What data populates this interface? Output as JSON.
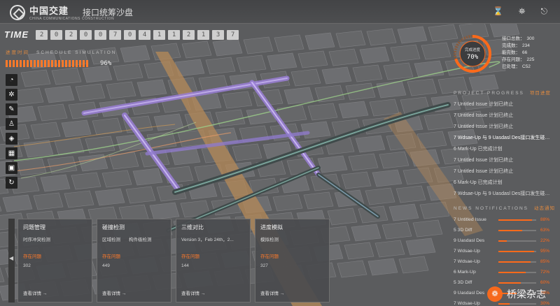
{
  "header": {
    "logo_text": "中国交建",
    "logo_sub": "CHINA COMMUNICATIONS CONSTRUCTION",
    "app_title": "接口统筹沙盘",
    "icons": [
      "hourglass-icon",
      "users-icon",
      "exit-icon"
    ]
  },
  "time": {
    "label": "TIME",
    "digits": [
      "2020",
      "07",
      "04",
      "11",
      "21",
      "37"
    ]
  },
  "schedule": {
    "label": "进度时间",
    "title": "SCHEDULE  SIMULATION"
  },
  "progress": {
    "percent_text": "96%",
    "value": 0.96
  },
  "sidebar_icons": [
    "pie-chart-icon",
    "gear-icon",
    "ruler-icon",
    "user-icon",
    "layers-icon",
    "map-icon",
    "grid-icon",
    "rotate-icon"
  ],
  "gauge": {
    "label": "完成进度",
    "value_text": "70%",
    "value": 0.7
  },
  "stats": [
    {
      "label": "接口总数：",
      "value": "300"
    },
    {
      "label": "完成数：",
      "value": "234"
    },
    {
      "label": "能完数：",
      "value": "66"
    },
    {
      "label": "存在问题：",
      "value": "225"
    },
    {
      "label": "已处理：",
      "value": "C52"
    }
  ],
  "project_progress": {
    "title": "PROJECT  PROGRESS",
    "tag": "项目进度",
    "items": [
      "7 Untitled Issue 计划已终止",
      "7 Untitled Issue 计划已终止",
      "7 Untitled Issue 计划已终止",
      "7 Wdsae-Up 与 9 Uasdasl Des接口发生碰…",
      "6 Mark-Up 已完成计划",
      "7 Untitled Issue 计划已终止",
      "7 Untitled Issue 计划已终止",
      "6 Mark-Up 已完成计划",
      "7 Wdsae-Up 与 9 Uasdasl Des接口发生碰…"
    ]
  },
  "notifications": {
    "title": "NEWS  NOTIFICATIONS",
    "tag": "动态通知",
    "items": [
      {
        "label": "7 Untitled Issue",
        "pct": "88%",
        "value": 0.88
      },
      {
        "label": "5 3D Diff",
        "pct": "63%",
        "value": 0.63
      },
      {
        "label": "9 Uasdasl Des",
        "pct": "22%",
        "value": 0.22
      },
      {
        "label": "7 Wdsae-Up",
        "pct": "95%",
        "value": 0.95
      },
      {
        "label": "7 Wdsae-Up",
        "pct": "85%",
        "value": 0.85
      },
      {
        "label": "6 Mark-Up",
        "pct": "72%",
        "value": 0.72
      },
      {
        "label": "5 3D Diff",
        "pct": "60%",
        "value": 0.6
      },
      {
        "label": "9 Uasdasl Des",
        "pct": "48%",
        "value": 0.48
      },
      {
        "label": "7 Wdsae-Up",
        "pct": "30%",
        "value": 0.3
      }
    ]
  },
  "cards": [
    {
      "title": "问题管理",
      "subs": [
        "时序冲突检测"
      ],
      "warn": "存在问题",
      "num": "302",
      "link": "查看详情"
    },
    {
      "title": "碰撞检测",
      "subs": [
        "区域检测",
        "构件级检测"
      ],
      "warn": "存在问题",
      "num": "449",
      "link": "查看详情"
    },
    {
      "title": "三维对比",
      "subs": [
        "Version 3，Feb 24th，2..."
      ],
      "warn": "存在问题",
      "num": "144",
      "link": "查看详情"
    },
    {
      "title": "进度模拟",
      "subs": [
        "模拟检测"
      ],
      "warn": "存在问题",
      "num": "327",
      "link": "查看详情"
    }
  ],
  "cards_toggle": "◀",
  "watermark": "桥梁杂志",
  "colors": {
    "accent": "#ff6a1a",
    "tunnel": "#9a7fd6",
    "road": "#c89a5a",
    "route_green": "#9ccf8a"
  }
}
